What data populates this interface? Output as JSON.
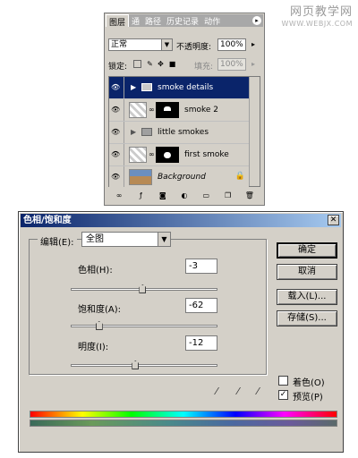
{
  "watermark": {
    "title": "网页教学网",
    "url": "WWW.WEBJX.COM"
  },
  "layers_panel": {
    "tabs": [
      "图层",
      "通",
      "路径",
      "历史记录",
      "动作"
    ],
    "blend_mode": "正常",
    "opacity_label": "不透明度:",
    "opacity_value": "100%",
    "lock_label": "锁定:",
    "fill_label": "填充:",
    "fill_value": "100%",
    "layers": [
      {
        "name": "smoke details",
        "type": "group",
        "selected": true
      },
      {
        "name": "smoke 2",
        "type": "layer-with-mask",
        "selected": false
      },
      {
        "name": "little smokes",
        "type": "group",
        "selected": false
      },
      {
        "name": "first smoke",
        "type": "layer-with-mask",
        "selected": false
      },
      {
        "name": "Background",
        "type": "background",
        "selected": false
      }
    ]
  },
  "dialog": {
    "title": "色相/饱和度",
    "edit_label": "编辑(E):",
    "edit_value": "全图",
    "hue": {
      "label": "色相(H):",
      "value": "-3",
      "fraction": 0.49
    },
    "saturation": {
      "label": "饱和度(A):",
      "value": "-62",
      "fraction": 0.19
    },
    "lightness": {
      "label": "明度(I):",
      "value": "-12",
      "fraction": 0.44
    },
    "buttons": {
      "ok": "确定",
      "cancel": "取消",
      "load": "载入(L)...",
      "save": "存储(S)..."
    },
    "colorize_label": "着色(O)",
    "colorize_checked": false,
    "preview_label": "预览(P)",
    "preview_checked": true
  }
}
